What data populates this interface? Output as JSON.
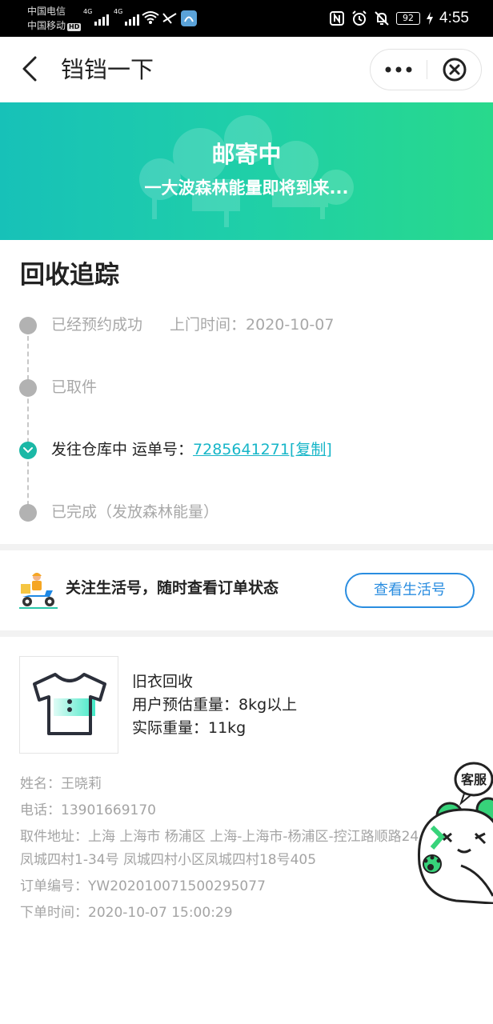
{
  "status_bar": {
    "carrier_1": "中国电信",
    "carrier_2": "中国移动",
    "hd_badge": "HD",
    "network_1": "4G",
    "network_2": "4G",
    "battery": "92",
    "time": "4:55",
    "icons": [
      "signal-icon",
      "wifi-icon",
      "nfc-icon",
      "alarm-icon",
      "mute-icon",
      "battery-icon",
      "charging-icon"
    ]
  },
  "nav": {
    "title": "铛铛一下",
    "back_icon": "chevron-left-icon",
    "more_icon": "more-dots-icon",
    "close_icon": "close-circle-icon"
  },
  "banner": {
    "title": "邮寄中",
    "subtitle": "一大波森林能量即将到来..."
  },
  "tracking": {
    "title": "回收追踪",
    "steps": [
      {
        "label": "已经预约成功",
        "extra": "上门时间：2020-10-07",
        "status": "done"
      },
      {
        "label": "已取件",
        "status": "done"
      },
      {
        "label": "发往仓库中 运单号：",
        "waybill": "7285641271[复制]",
        "status": "current"
      },
      {
        "label": "已完成（发放森林能量）",
        "status": "pending"
      }
    ],
    "colors": {
      "active": "#1bb8a6",
      "inactive": "#b2b2b2",
      "link": "#17b6c8"
    }
  },
  "follow": {
    "text": "关注生活号，随时查看订单状态",
    "button_label": "查看生活号",
    "icon": "delivery-scooter-icon"
  },
  "order": {
    "product_icon": "tshirt-icon",
    "product_name": "旧衣回收",
    "estimated_weight": "用户预估重量：8kg以上",
    "actual_weight": "实际重量：11kg",
    "name": "姓名：王晓莉",
    "phone": "电话：13901669170",
    "address": "取件地址：上海 上海市 杨浦区 上海-上海市-杨浦区-控江路顺路24凤城四村1-34号 凤城四村小区凤城四村18号405",
    "order_no": "订单编号：YW202010071500295077",
    "order_time": "下单时间：2020-10-07 15:00:29"
  },
  "customer_service": {
    "label": "客服",
    "icon": "panda-mascot-icon"
  },
  "colors": {
    "banner_start": "#17c1b8",
    "banner_end": "#28d98c",
    "follow_button": "#2a8de0"
  }
}
